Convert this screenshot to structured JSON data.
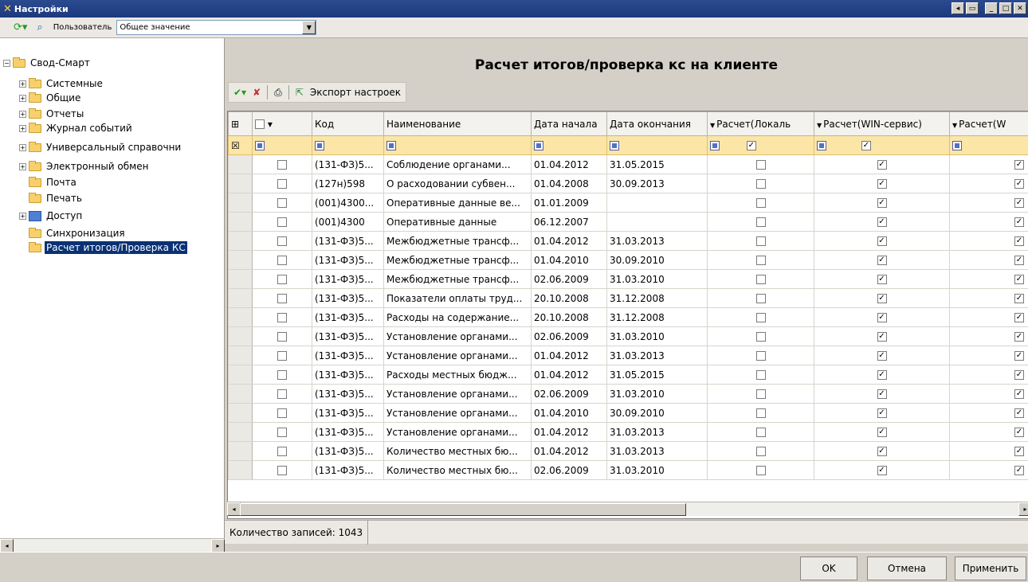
{
  "window": {
    "title": "Настройки"
  },
  "toolbar": {
    "user_label": "Пользователь",
    "user_value": "Общее значение"
  },
  "tree": {
    "items": [
      {
        "label": "Свод-Смарт",
        "expander": "−",
        "icon": "folder"
      },
      {
        "label": "Системные",
        "expander": "+",
        "icon": "folder"
      },
      {
        "label": "Общие",
        "expander": "+",
        "icon": "folder"
      },
      {
        "label": "Отчеты",
        "expander": "+",
        "icon": "folder"
      },
      {
        "label": "Журнал событий",
        "expander": "+",
        "icon": "folder"
      },
      {
        "label": "Универсальный справочни",
        "expander": "+",
        "icon": "folder"
      },
      {
        "label": "Электронный обмен",
        "expander": "+",
        "icon": "folder"
      },
      {
        "label": "Почта",
        "expander": "",
        "icon": "folder"
      },
      {
        "label": "Печать",
        "expander": "",
        "icon": "folder"
      },
      {
        "label": "Доступ",
        "expander": "+",
        "icon": "computer"
      },
      {
        "label": "Синхронизация",
        "expander": "",
        "icon": "folder"
      },
      {
        "label": "Расчет итогов/Проверка КС",
        "expander": "",
        "icon": "folder",
        "selected": true
      }
    ]
  },
  "main": {
    "heading": "Расчет итогов/проверка кс на клиенте",
    "export_label": "Экспорт настроек",
    "columns": [
      "Код",
      "Наименование",
      "Дата начала",
      "Дата окончания",
      "Расчет(Локаль",
      "Расчет(WIN-сервис)",
      "Расчет(W"
    ],
    "rows": [
      {
        "code": "(131-ФЗ)5...",
        "name": "Соблюдение органами...",
        "start": "01.04.2012",
        "end": "31.05.2015"
      },
      {
        "code": "(127н)598",
        "name": "О расходовании субвен...",
        "start": "01.04.2008",
        "end": "30.09.2013"
      },
      {
        "code": "(001)4300...",
        "name": "Оперативные данные ве...",
        "start": "01.01.2009",
        "end": ""
      },
      {
        "code": "(001)4300",
        "name": "Оперативные данные",
        "start": "06.12.2007",
        "end": ""
      },
      {
        "code": "(131-ФЗ)5...",
        "name": "Межбюджетные трансф...",
        "start": "01.04.2012",
        "end": "31.03.2013"
      },
      {
        "code": "(131-ФЗ)5...",
        "name": "Межбюджетные трансф...",
        "start": "01.04.2010",
        "end": "30.09.2010"
      },
      {
        "code": "(131-ФЗ)5...",
        "name": "Межбюджетные трансф...",
        "start": "02.06.2009",
        "end": "31.03.2010"
      },
      {
        "code": "(131-ФЗ)5...",
        "name": "Показатели оплаты труд...",
        "start": "20.10.2008",
        "end": "31.12.2008"
      },
      {
        "code": "(131-ФЗ)5...",
        "name": "Расходы на содержание...",
        "start": "20.10.2008",
        "end": "31.12.2008"
      },
      {
        "code": "(131-ФЗ)5...",
        "name": "Установление органами...",
        "start": "02.06.2009",
        "end": "31.03.2010"
      },
      {
        "code": "(131-ФЗ)5...",
        "name": "Установление органами...",
        "start": "01.04.2012",
        "end": "31.03.2013"
      },
      {
        "code": "(131-ФЗ)5...",
        "name": "Расходы местных бюдж...",
        "start": "01.04.2012",
        "end": "31.05.2015"
      },
      {
        "code": "(131-ФЗ)5...",
        "name": "Установление органами...",
        "start": "02.06.2009",
        "end": "31.03.2010"
      },
      {
        "code": "(131-ФЗ)5...",
        "name": "Установление органами...",
        "start": "01.04.2010",
        "end": "30.09.2010"
      },
      {
        "code": "(131-ФЗ)5...",
        "name": "Установление органами...",
        "start": "01.04.2012",
        "end": "31.03.2013"
      },
      {
        "code": "(131-ФЗ)5...",
        "name": "Количество местных бю...",
        "start": "01.04.2012",
        "end": "31.03.2013"
      },
      {
        "code": "(131-ФЗ)5...",
        "name": "Количество местных бю...",
        "start": "02.06.2009",
        "end": "31.03.2010"
      }
    ],
    "status": "Количество записей: 1043"
  },
  "buttons": {
    "ok": "OK",
    "cancel": "Отмена",
    "apply": "Применить"
  },
  "colors": {
    "selection": "#0a3176",
    "filter_row": "#fbe6a8",
    "titlebar": "#1b3a7e"
  }
}
